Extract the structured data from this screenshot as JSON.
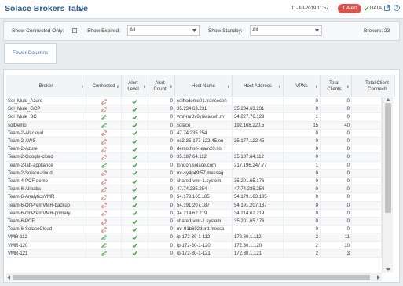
{
  "header": {
    "title": "Solace Brokers Table",
    "timestamp": "11-Jul-2019 11:57",
    "alert_badge": "1 Alert",
    "data_label": "DATA"
  },
  "filters": {
    "connected_only_label": "Show Connected Only:",
    "expired_label": "Show Expired:",
    "expired_value": "All",
    "standby_label": "Show Standby:",
    "standby_value": "All",
    "brokers_count": "Brokers: 23"
  },
  "fewer_columns_label": "Fewer Columns",
  "colors": {
    "title": "#2f5c8a",
    "alert_badge": "#d9534f",
    "ok_green": "#3fa43f",
    "disconnected_red": "#d9534f"
  },
  "table": {
    "headers": [
      "Broker",
      "Connected",
      "Alert Level",
      "Alert Count",
      "Host Name",
      "Host Address",
      "VPNs",
      "Total Clients",
      "Total Client Connecti"
    ],
    "rows": [
      {
        "broker": "Sol_Mule_Azure",
        "connected": false,
        "alert_count": "0",
        "host_name": "solhcdemo01.francecen",
        "host_address": "",
        "vpns": "0",
        "clients": "0"
      },
      {
        "broker": "Sol_Mule_GCP",
        "connected": false,
        "alert_count": "0",
        "host_name": "35.234.63.231",
        "host_address": "35.234.63.231",
        "vpns": "0",
        "clients": "0"
      },
      {
        "broker": "Sol_Mule_SC",
        "connected": true,
        "alert_count": "0",
        "host_name": "vmr-mr8v6yriwaxwh.m",
        "host_address": "34.227.76.129",
        "vpns": "1",
        "clients": "0"
      },
      {
        "broker": "solDemo",
        "connected": true,
        "alert_count": "0",
        "host_name": "solace",
        "host_address": "192.168.220.5",
        "vpns": "15",
        "clients": "40"
      },
      {
        "broker": "Team-2-All-cloud",
        "connected": false,
        "alert_count": "0",
        "host_name": "47.74.235.254",
        "host_address": "",
        "vpns": "0",
        "clients": "0"
      },
      {
        "broker": "Team-2-AWS",
        "connected": false,
        "alert_count": "0",
        "host_name": "ec2-35-177-122-45.eu",
        "host_address": "35.177.122.45",
        "vpns": "0",
        "clients": "0"
      },
      {
        "broker": "Team-2-Azure",
        "connected": false,
        "alert_count": "0",
        "host_name": "demothon-team20.sol",
        "host_address": "",
        "vpns": "0",
        "clients": "0"
      },
      {
        "broker": "Team-2-Google-cloud",
        "connected": false,
        "alert_count": "0",
        "host_name": "35.187.64.112",
        "host_address": "35.187.64.112",
        "vpns": "0",
        "clients": "0"
      },
      {
        "broker": "Team-2-lab-appliance",
        "connected": true,
        "alert_count": "0",
        "host_name": "london.solace.com",
        "host_address": "217.196.247.77",
        "vpns": "1",
        "clients": "0"
      },
      {
        "broker": "Team-2-Solace-cloud",
        "connected": false,
        "alert_count": "0",
        "host_name": "mr-sy4p49t57.messag",
        "host_address": "",
        "vpns": "0",
        "clients": "0"
      },
      {
        "broker": "Team-4-PCF-demo",
        "connected": false,
        "alert_count": "0",
        "host_name": "shared-vmr-1.system.",
        "host_address": "35.201.65.176",
        "vpns": "0",
        "clients": "0"
      },
      {
        "broker": "Team-6-Alibaba",
        "connected": false,
        "alert_count": "0",
        "host_name": "47.74.235.254",
        "host_address": "47.74.235.254",
        "vpns": "0",
        "clients": "0"
      },
      {
        "broker": "Team-6-AnalyticsVMR",
        "connected": false,
        "alert_count": "0",
        "host_name": "54.179.163.185",
        "host_address": "54.179.163.185",
        "vpns": "0",
        "clients": "0"
      },
      {
        "broker": "Team-6-OnPremVMR-backup",
        "connected": false,
        "alert_count": "0",
        "host_name": "54.191.207.187",
        "host_address": "54.191.207.187",
        "vpns": "0",
        "clients": "0"
      },
      {
        "broker": "Team-6-OnPremVMR-primary",
        "connected": false,
        "alert_count": "0",
        "host_name": "34.214.62.219",
        "host_address": "34.214.62.219",
        "vpns": "0",
        "clients": "0"
      },
      {
        "broker": "Team-6-PCF",
        "connected": false,
        "alert_count": "0",
        "host_name": "shared-vmr-1.system.",
        "host_address": "35.201.65.176",
        "vpns": "0",
        "clients": "0"
      },
      {
        "broker": "Team-6-SolaceCloud",
        "connected": false,
        "alert_count": "0",
        "host_name": "mr-91b692durd.messa",
        "host_address": "",
        "vpns": "0",
        "clients": "0"
      },
      {
        "broker": "VMR-112",
        "connected": true,
        "alert_count": "0",
        "host_name": "ip-172-30-1-112",
        "host_address": "172.30.1.112",
        "vpns": "2",
        "clients": "11"
      },
      {
        "broker": "VMR-120",
        "connected": true,
        "alert_count": "0",
        "host_name": "ip-172-30-1-120",
        "host_address": "172.30.1.120",
        "vpns": "2",
        "clients": "10"
      },
      {
        "broker": "VMR-121",
        "connected": true,
        "alert_count": "0",
        "host_name": "ip-172-30-1-121",
        "host_address": "172.30.1.121",
        "vpns": "2",
        "clients": "3"
      }
    ]
  }
}
